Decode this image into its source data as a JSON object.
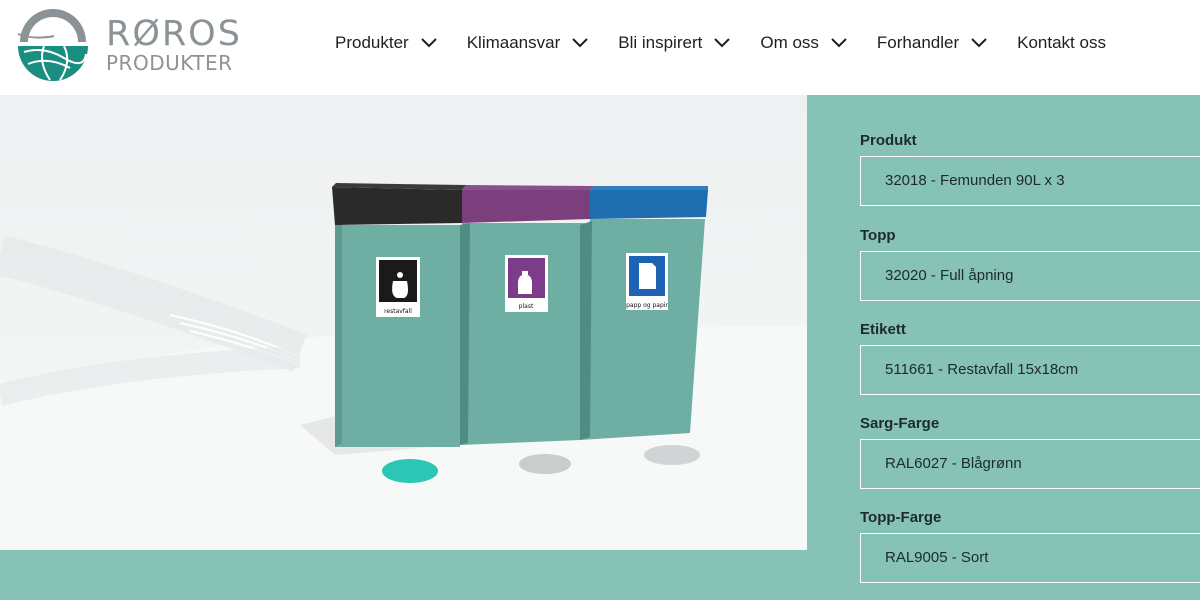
{
  "brand": {
    "name_line1": "RØROS",
    "name_line2": "PRODUKTER"
  },
  "nav": {
    "items": [
      {
        "label": "Produkter",
        "has_dropdown": true
      },
      {
        "label": "Klimaansvar",
        "has_dropdown": true
      },
      {
        "label": "Bli inspirert",
        "has_dropdown": true
      },
      {
        "label": "Om oss",
        "has_dropdown": true
      },
      {
        "label": "Forhandler",
        "has_dropdown": true
      },
      {
        "label": "Kontakt oss",
        "has_dropdown": false
      }
    ]
  },
  "viewer": {
    "bins": [
      {
        "lid_color": "#2a2a2a",
        "label_text": "restavfall",
        "label_color": "#1a1a1a",
        "icon": "trash-bag-icon"
      },
      {
        "lid_color": "#7b3f7e",
        "label_text": "plast",
        "label_color": "#7d3c8a",
        "icon": "bottle-icon"
      },
      {
        "lid_color": "#1f6fb0",
        "label_text": "papp og papir",
        "label_color": "#1e63b3",
        "icon": "paper-icon"
      }
    ],
    "body_color": "#6fafa3",
    "selected_indicator_color": "#2bc6b4"
  },
  "config": {
    "fields": [
      {
        "label": "Produkt",
        "value": "32018 - Femunden 90L x 3"
      },
      {
        "label": "Topp",
        "value": "32020 - Full åpning"
      },
      {
        "label": "Etikett",
        "value": "511661 - Restavfall 15x18cm"
      },
      {
        "label": "Sarg-Farge",
        "value": "RAL6027 - Blågrønn"
      },
      {
        "label": "Topp-Farge",
        "value": "RAL9005 - Sort"
      }
    ]
  },
  "colors": {
    "accent": "#86c2b6",
    "logo_teal": "#1a8e80",
    "logo_gray": "#8c9396"
  }
}
